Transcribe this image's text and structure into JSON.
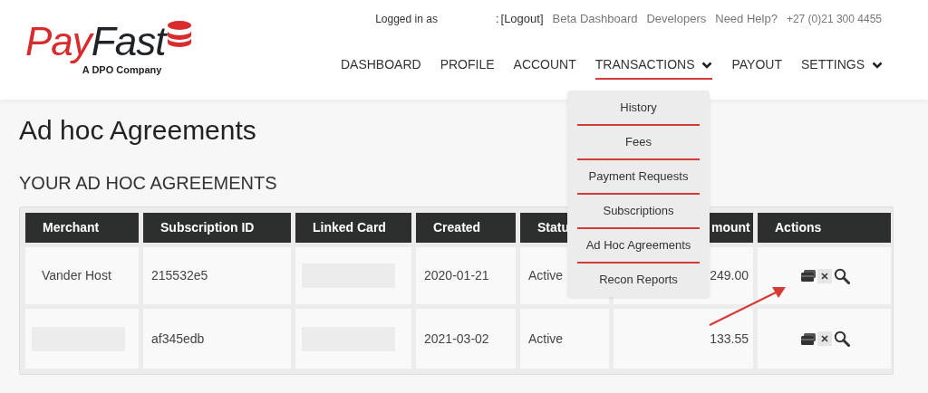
{
  "top_bar": {
    "logged_in_label": "Logged in as",
    "separator": ":",
    "logout_link": "[Logout]",
    "links": [
      "Beta Dashboard",
      "Developers",
      "Need Help?"
    ],
    "phone": "+27 (0)21 300 4455"
  },
  "logo": {
    "part_1": "Pay",
    "part_2": "Fast",
    "tagline": "A DPO Company"
  },
  "nav": [
    {
      "label": "DASHBOARD",
      "selected": false,
      "has_menu": false
    },
    {
      "label": "PROFILE",
      "selected": false,
      "has_menu": false
    },
    {
      "label": "ACCOUNT",
      "selected": false,
      "has_menu": false
    },
    {
      "label": "TRANSACTIONS",
      "selected": true,
      "has_menu": true
    },
    {
      "label": "PAYOUT",
      "selected": false,
      "has_menu": false
    },
    {
      "label": "SETTINGS",
      "selected": false,
      "has_menu": true
    }
  ],
  "dropdown": [
    "History",
    "Fees",
    "Payment Requests",
    "Subscriptions",
    "Ad Hoc Agreements",
    "Recon Reports"
  ],
  "page_title": "Ad hoc Agreements",
  "section_title": "YOUR AD HOC AGREEMENTS",
  "table": {
    "columns": [
      "Merchant",
      "Subscription ID",
      "Linked Card",
      "Created",
      "Statu",
      "mount",
      "Actions"
    ],
    "rows": [
      {
        "cells": [
          {
            "text": "Vander Host"
          },
          {
            "text": "215532e5"
          },
          {
            "redacted": true
          },
          {
            "text": "2020-01-21"
          },
          {
            "text": "Active"
          },
          {
            "text": "249.00"
          }
        ]
      },
      {
        "cells": [
          {
            "redacted": true
          },
          {
            "text": "af345edb"
          },
          {
            "redacted": true
          },
          {
            "text": "2021-03-02"
          },
          {
            "text": "Active"
          },
          {
            "text": "133.55"
          }
        ]
      }
    ]
  }
}
